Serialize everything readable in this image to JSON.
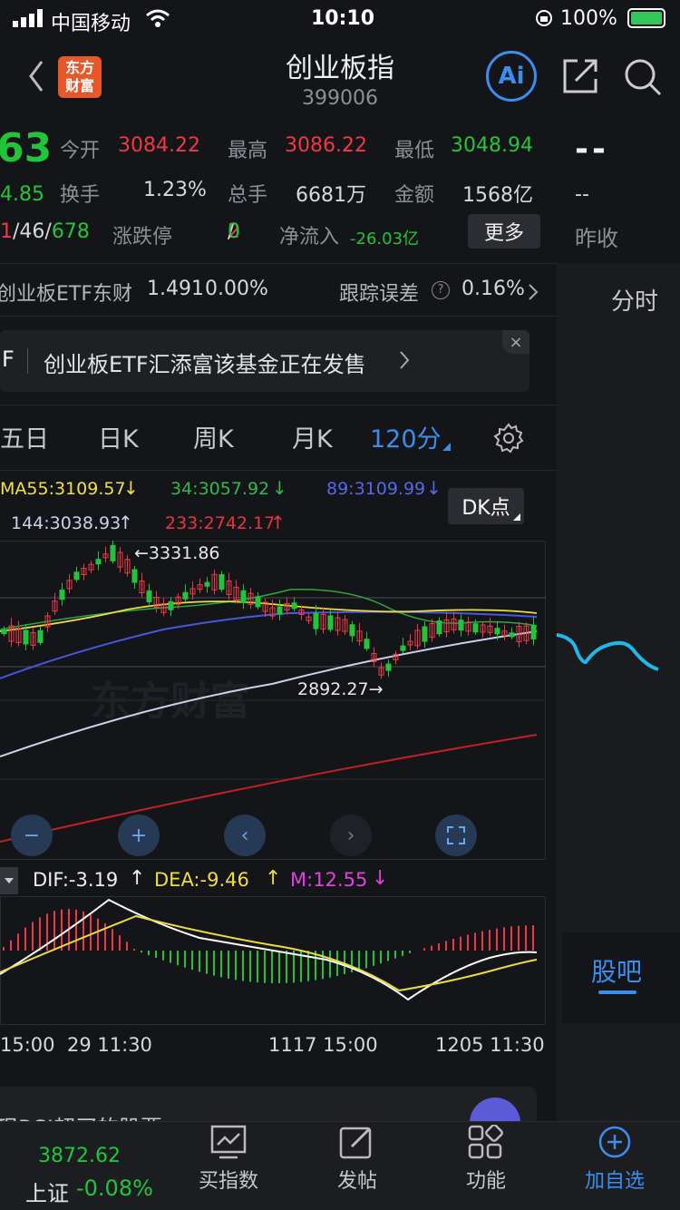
{
  "status_bar": {
    "carrier": "中国移动",
    "time": "10:10",
    "battery": "100%"
  },
  "header": {
    "title": "创业板指",
    "code": "399006",
    "logo_text_1": "东方",
    "logo_text_2": "财富",
    "ai_label": "Ai"
  },
  "quote": {
    "price_partial": "63",
    "change_partial": "4.85",
    "ratio_a": "1",
    "ratio_b": "/46/",
    "ratio_c": "678",
    "open_label": "今开",
    "open_value": "3084.22",
    "high_label": "最高",
    "high_value": "3086.22",
    "low_label": "最低",
    "low_value": "3048.94",
    "turnover_label": "换手",
    "turnover_value": "1.23%",
    "volume_label": "总手",
    "volume_value": "6681万",
    "amount_label": "金额",
    "amount_value": "1568亿",
    "limit_label": "涨跌停",
    "limit_up": "2",
    "limit_slash": "/",
    "limit_down": "0",
    "inflow_label": "净流入",
    "inflow_value": "-26.03亿",
    "more_button": "更多"
  },
  "right_panel": {
    "dash_big": "--",
    "dash_small": "--",
    "prev_close_label": "昨收",
    "time_share_tab": "分时",
    "guba_tab": "股吧"
  },
  "etf_row": {
    "name": "创业板ETF东财",
    "price": "1.491",
    "change": "0.00%",
    "tracking_label": "跟踪误差",
    "tracking_value": "0.16%"
  },
  "banner": {
    "tag": "F",
    "text": "创业板ETF汇添富该基金正在发售"
  },
  "period_tabs": [
    "五日",
    "日K",
    "周K",
    "月K",
    "120分"
  ],
  "ma_legend": {
    "ma55": "MA55:3109.57",
    "ma34": "34:3057.92",
    "ma89": "89:3109.99",
    "ma144": "144:3038.93",
    "ma233": "233:2742.17",
    "dk_button": "DK点"
  },
  "chart_annotations": {
    "high": "3331.86",
    "low": "2892.27",
    "watermark": "东方财富"
  },
  "macd_legend": {
    "dif": "DIF:-3.19",
    "dea": "DEA:-9.46",
    "m": "M:12.55"
  },
  "time_axis": [
    "15:00",
    "29 11:30",
    "1117 15:00",
    "1205 11:30"
  ],
  "promo": {
    "text": "现RSI超买的股票"
  },
  "bottom_nav": {
    "index_price": "3872.62",
    "index_name": "上证",
    "index_change": "-0.08%",
    "buy_index": "买指数",
    "post": "发帖",
    "functions": "功能",
    "add_watch": "加自选"
  },
  "colors": {
    "up": "#f23645",
    "down": "#22c53a",
    "accent": "#3a8ef0",
    "background": "#141518"
  },
  "chart_data": {
    "type": "candlestick",
    "annotations": {
      "max": 3331.86,
      "min": 2892.27
    },
    "series": [
      {
        "name": "MA55",
        "last": 3109.57
      },
      {
        "name": "34",
        "last": 3057.92
      },
      {
        "name": "89",
        "last": 3109.99
      },
      {
        "name": "144",
        "last": 3038.93
      },
      {
        "name": "233",
        "last": 2742.17
      },
      {
        "name": "DIF",
        "last": -3.19
      },
      {
        "name": "DEA",
        "last": -9.46
      },
      {
        "name": "M",
        "last": 12.55
      }
    ]
  }
}
